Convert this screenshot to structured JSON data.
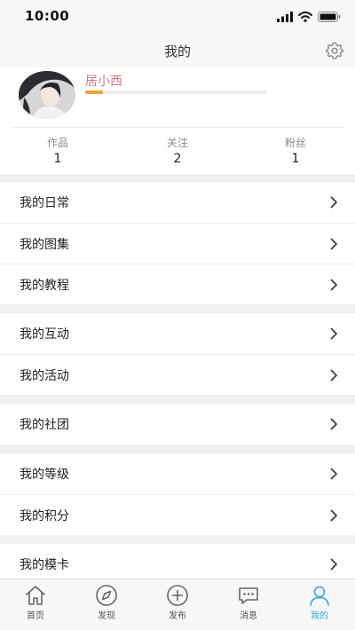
{
  "status_bar": {
    "time": "10:00"
  },
  "header": {
    "title": "我的"
  },
  "profile": {
    "username": "居小西",
    "level_progress": 0.1,
    "stats": [
      {
        "label": "作品",
        "value": "1"
      },
      {
        "label": "关注",
        "value": "2"
      },
      {
        "label": "粉丝",
        "value": "1"
      }
    ]
  },
  "menu": {
    "groups": [
      {
        "items": [
          {
            "label": "我的日常"
          },
          {
            "label": "我的图集"
          },
          {
            "label": "我的教程"
          }
        ]
      },
      {
        "items": [
          {
            "label": "我的互动"
          },
          {
            "label": "我的活动"
          }
        ]
      },
      {
        "items": [
          {
            "label": "我的社团"
          }
        ]
      },
      {
        "items": [
          {
            "label": "我的等级"
          },
          {
            "label": "我的积分"
          }
        ]
      },
      {
        "items": [
          {
            "label": "我的模卡"
          }
        ]
      }
    ]
  },
  "tab_bar": {
    "tabs": [
      {
        "label": "首页",
        "icon": "home-icon"
      },
      {
        "label": "发现",
        "icon": "compass-icon"
      },
      {
        "label": "发布",
        "icon": "plus-circle-icon"
      },
      {
        "label": "消息",
        "icon": "chat-icon"
      },
      {
        "label": "我的",
        "icon": "user-icon",
        "active": true
      }
    ],
    "active_color": "#3aa6dd"
  },
  "colors": {
    "username": "#d27a86",
    "level_fill": "#f0a23a"
  }
}
